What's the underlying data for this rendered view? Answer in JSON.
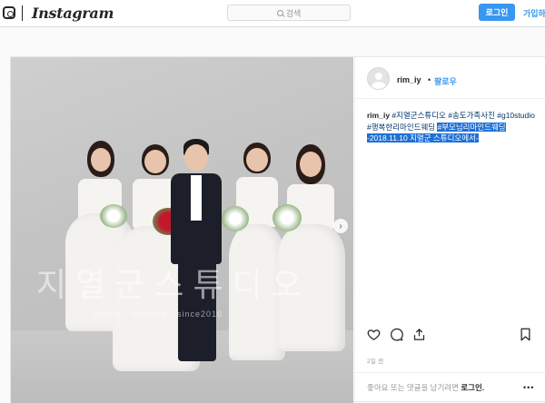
{
  "topbar": {
    "logo_icon": "instagram-camera-icon",
    "wordmark": "Instagram",
    "search_placeholder": "검색",
    "search_icon": "search-icon",
    "login_label": "로그인",
    "signup_label": "가입하"
  },
  "post": {
    "username": "rim_iy",
    "dot": "•",
    "follow_label": "팔로우",
    "caption": {
      "user": "rim_iy",
      "tags_1": " #지열군스튜디오 #송도가족사진 #g10studio #행복한리마인드웨딩 ",
      "highlighted": "#부모님리마인드웨딩 -2018.11.10 지열군 스튜디오에서-"
    },
    "photo": {
      "watermark": "지열군스튜디오",
      "watermark_sub": "simple · lifestyle · since2010"
    },
    "next_arrow": "›",
    "time_ago": "2일 전",
    "comment_prompt": "좋아요 또는 댓글을 남기려면",
    "comment_login_link": "로그인.",
    "more_label": "•••",
    "icons": [
      "heart-icon",
      "comment-icon",
      "share-icon",
      "save-icon",
      "next-arrow-icon"
    ]
  },
  "colors": {
    "accent": "#3897f0",
    "text": "#262626",
    "muted": "#999999",
    "highlight": "#1e70d6"
  }
}
